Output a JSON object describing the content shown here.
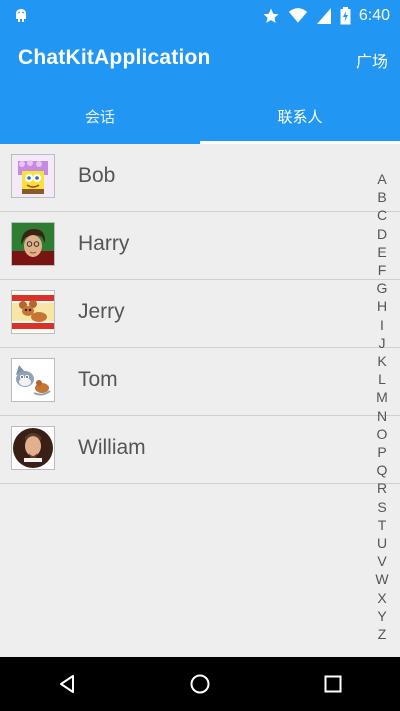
{
  "status_bar": {
    "time": "6:40",
    "icons": [
      "android-debug-icon",
      "star-icon",
      "wifi-icon",
      "signal-icon",
      "battery-charging-icon"
    ]
  },
  "app_bar": {
    "title": "ChatKitApplication",
    "action_label": "广场"
  },
  "tabs": [
    {
      "label": "会话",
      "active": false
    },
    {
      "label": "联系人",
      "active": true
    }
  ],
  "contacts": [
    {
      "name": "Bob",
      "avatar_icon": "spongebob-avatar-icon"
    },
    {
      "name": "Harry",
      "avatar_icon": "harry-avatar-icon"
    },
    {
      "name": "Jerry",
      "avatar_icon": "jerry-avatar-icon"
    },
    {
      "name": "Tom",
      "avatar_icon": "tom-avatar-icon"
    },
    {
      "name": "William",
      "avatar_icon": "shakespeare-avatar-icon"
    }
  ],
  "alphabet_index": [
    "A",
    "B",
    "C",
    "D",
    "E",
    "F",
    "G",
    "H",
    "I",
    "J",
    "K",
    "L",
    "M",
    "N",
    "O",
    "P",
    "Q",
    "R",
    "S",
    "T",
    "U",
    "V",
    "W",
    "X",
    "Y",
    "Z"
  ],
  "nav_bar": {
    "icons": [
      "back-icon",
      "home-icon",
      "recents-icon"
    ]
  },
  "colors": {
    "primary": "#2196f3",
    "background": "#eeeeee",
    "text": "#555555"
  }
}
